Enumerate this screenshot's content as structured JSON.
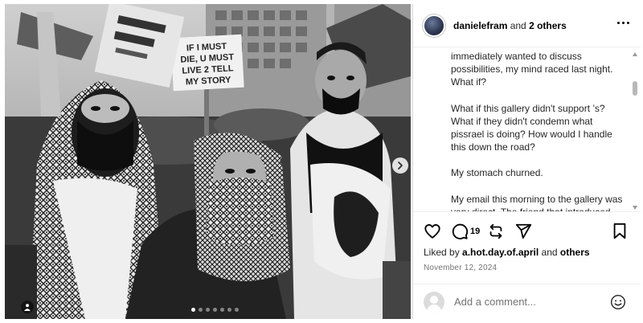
{
  "post": {
    "author": "danielefram",
    "coauthors_text": "and",
    "coauthors_count": "2 others",
    "caption_paragraphs": [
      "immediately wanted to discuss possibilities, my mind raced last night. What if?",
      "What if this gallery didn't support ’s? What if they didn't condemn what pissrael is doing? How would I handle this down the road?",
      "My stomach churned.",
      "My email this morning to the gallery was very direct. The friend that introduced me thought it may have"
    ],
    "comment_count": "19",
    "likes_prefix": "Liked by",
    "likes_user": "a.hot.day.of.april",
    "likes_and": "and",
    "likes_others": "others",
    "date": "November 12, 2024",
    "comment_placeholder": "Add a comment..."
  },
  "photo": {
    "sign_text": [
      "IF I MUST",
      "DIE, U MUST",
      "LIVE 2 TELL",
      "MY STORY"
    ],
    "slide_count": 7,
    "active_slide": 1
  },
  "icons": {
    "like": "heart-icon",
    "comment": "comment-icon",
    "share": "repost-icon",
    "send": "send-icon",
    "save": "bookmark-icon",
    "more": "more-icon",
    "emoji": "emoji-icon",
    "next": "chevron-right-icon",
    "tag": "user-tag-icon"
  }
}
